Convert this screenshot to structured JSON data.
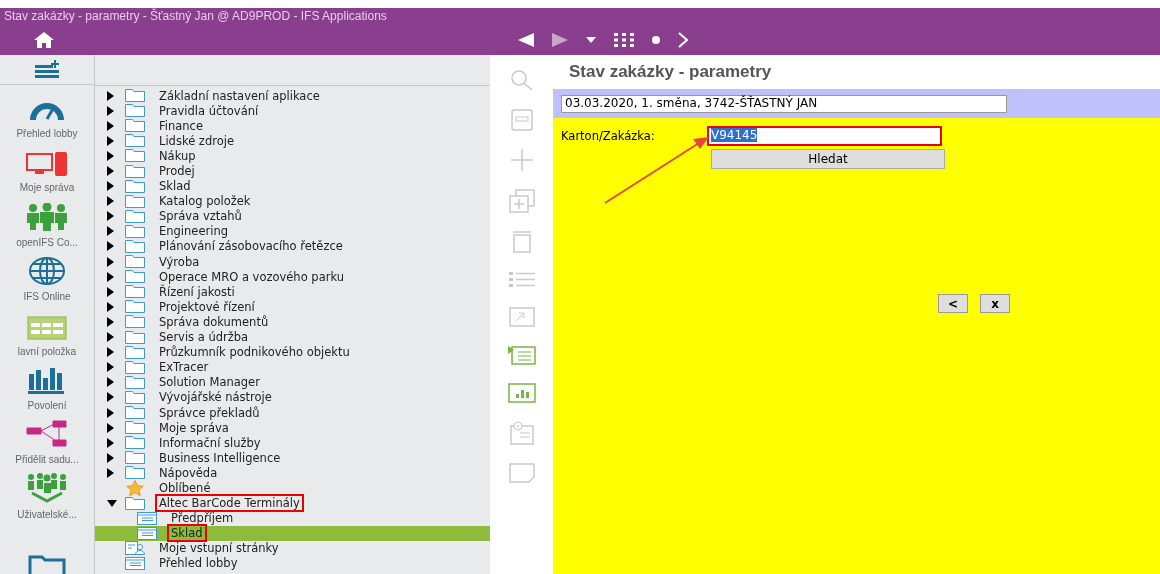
{
  "window": {
    "title": "Stav zakázky - parametry - Šťastný Jan @ AD9PROD - IFS Applications"
  },
  "sidebar": {
    "items": [
      {
        "kind": "gauge",
        "label": "Přehled lobby"
      },
      {
        "kind": "computer",
        "label": "Moje správa"
      },
      {
        "kind": "people",
        "label": "openIFS Co..."
      },
      {
        "kind": "globe",
        "label": "IFS Online"
      },
      {
        "kind": "table",
        "label": "lavní položka"
      },
      {
        "kind": "chart",
        "label": "Povolení"
      },
      {
        "kind": "network",
        "label": "Přidělit sadu..."
      },
      {
        "kind": "users",
        "label": "Uživatelské..."
      },
      {
        "kind": "folder"
      }
    ]
  },
  "tree": {
    "items": [
      {
        "kind": "folder",
        "label": "Základní nastavení aplikace",
        "expanded": false,
        "selected": false
      },
      {
        "kind": "folder",
        "label": "Pravidla účtování",
        "expanded": false,
        "selected": false
      },
      {
        "kind": "folder",
        "label": "Finance",
        "expanded": false,
        "selected": false
      },
      {
        "kind": "folder",
        "label": "Lidské zdroje",
        "expanded": false,
        "selected": false
      },
      {
        "kind": "folder",
        "label": "Nákup",
        "expanded": false,
        "selected": false
      },
      {
        "kind": "folder",
        "label": "Prodej",
        "expanded": false,
        "selected": false
      },
      {
        "kind": "folder",
        "label": "Sklad",
        "expanded": false,
        "selected": false
      },
      {
        "kind": "folder",
        "label": "Katalog položek",
        "expanded": false,
        "selected": false
      },
      {
        "kind": "folder",
        "label": "Správa vztahů",
        "expanded": false,
        "selected": false
      },
      {
        "kind": "folder",
        "label": "Engineering",
        "expanded": false,
        "selected": false
      },
      {
        "kind": "folder",
        "label": "Plánování zásobovacího řetězce",
        "expanded": false,
        "selected": false
      },
      {
        "kind": "folder",
        "label": "Výroba",
        "expanded": false,
        "selected": false
      },
      {
        "kind": "folder",
        "label": "Operace MRO a vozového parku",
        "expanded": false,
        "selected": false
      },
      {
        "kind": "folder",
        "label": "Řízení jakosti",
        "expanded": false,
        "selected": false
      },
      {
        "kind": "folder",
        "label": "Projektové řízení",
        "expanded": false,
        "selected": false
      },
      {
        "kind": "folder",
        "label": "Správa dokumentů",
        "expanded": false,
        "selected": false
      },
      {
        "kind": "folder",
        "label": "Servis a údržba",
        "expanded": false,
        "selected": false
      },
      {
        "kind": "folder",
        "label": "Průzkumník podnikového objektu",
        "expanded": false,
        "selected": false
      },
      {
        "kind": "folder",
        "label": "ExTracer",
        "expanded": false,
        "selected": false
      },
      {
        "kind": "folder",
        "label": "Solution Manager",
        "expanded": false,
        "selected": false
      },
      {
        "kind": "folder",
        "label": "Vývojářské nástroje",
        "expanded": false,
        "selected": false
      },
      {
        "kind": "folder",
        "label": "Správce překladů",
        "expanded": false,
        "selected": false
      },
      {
        "kind": "folder",
        "label": "Moje správa",
        "expanded": false,
        "selected": false
      },
      {
        "kind": "folder",
        "label": "Informační služby",
        "expanded": false,
        "selected": false
      },
      {
        "kind": "folder",
        "label": "Business Intelligence",
        "expanded": false,
        "selected": false
      },
      {
        "kind": "folder",
        "label": "Nápověda",
        "expanded": false,
        "selected": false
      },
      {
        "kind": "favorites",
        "label": "Oblíbené",
        "selected": false
      },
      {
        "kind": "folder",
        "label": "Altec BarCode Terminály",
        "expanded": true,
        "selected": false,
        "annotated": true,
        "children": [
          {
            "kind": "page",
            "label": "Předpříjem",
            "selected": false
          },
          {
            "kind": "page",
            "label": "Sklad",
            "selected": true,
            "annotated": true
          }
        ]
      },
      {
        "kind": "user-page",
        "label": "Moje vstupní stránky",
        "selected": false
      },
      {
        "kind": "page",
        "label": "Přehled lobby",
        "selected": false
      }
    ]
  },
  "form": {
    "title": "Stav zakázky - parametry",
    "header_field": {
      "value": "03.03.2020, 1. směna, 3742-ŠŤASTNÝ JAN"
    },
    "fields": [
      {
        "label": "Karton/Zakázka:",
        "value": "V94145",
        "annotated": true
      }
    ],
    "search_button": "Hledat",
    "buttons": [
      "<",
      "x"
    ]
  }
}
